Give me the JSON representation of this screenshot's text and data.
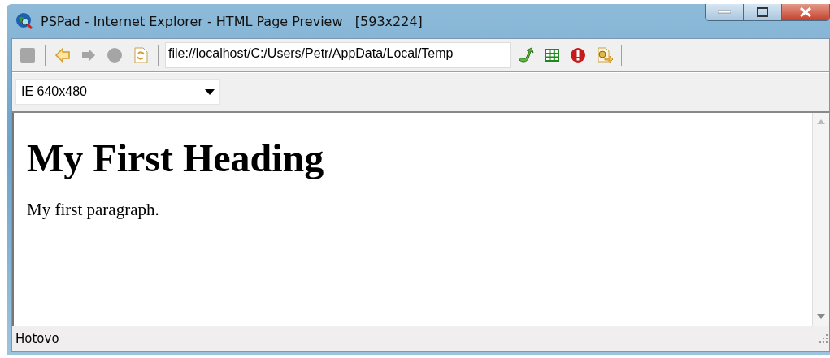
{
  "window": {
    "title": "PSPad - Internet Explorer - HTML Page Preview   [593x224]"
  },
  "toolbar": {
    "buttons_left": [
      {
        "kind": "square",
        "disabled": true
      },
      {
        "kind": "back",
        "disabled": false
      },
      {
        "kind": "forward",
        "disabled": true
      },
      {
        "kind": "stop",
        "disabled": true
      },
      {
        "kind": "refresh",
        "disabled": false
      }
    ],
    "address": "file://localhost/C:/Users/Petr/AppData/Local/Temp",
    "buttons_right": [
      {
        "kind": "go",
        "disabled": false
      },
      {
        "kind": "table",
        "disabled": false
      },
      {
        "kind": "error",
        "disabled": false
      },
      {
        "kind": "settings",
        "disabled": false
      }
    ]
  },
  "size_select": {
    "value": "IE 640x480"
  },
  "page": {
    "heading": "My First Heading",
    "paragraph": "My first paragraph."
  },
  "status_bar": {
    "text": "Hotovo"
  }
}
